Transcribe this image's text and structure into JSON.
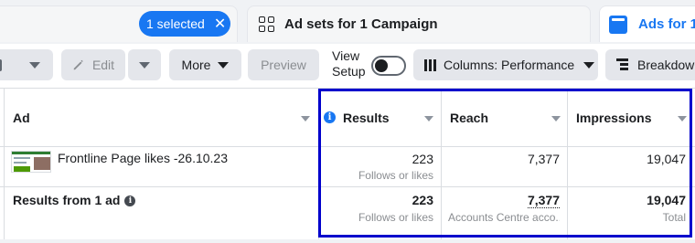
{
  "tabs": {
    "campaigns_selected_label": "1 selected",
    "adsets_label": "Ad sets for 1 Campaign",
    "ads_label": "Ads for 1"
  },
  "toolbar": {
    "edit_label": "Edit",
    "more_label": "More",
    "preview_label": "Preview",
    "view_setup_line1": "View",
    "view_setup_line2": "Setup",
    "columns_label": "Columns: Performance",
    "breakdown_label": "Breakdown"
  },
  "table": {
    "headers": {
      "ad": "Ad",
      "results": "Results",
      "reach": "Reach",
      "impressions": "Impressions"
    },
    "row": {
      "name": "Frontline Page likes -26.10.23",
      "results": "223",
      "results_sub": "Follows or likes",
      "reach": "7,377",
      "impressions": "19,047"
    },
    "summary": {
      "label": "Results from 1 ad",
      "results": "223",
      "results_sub": "Follows or likes",
      "reach": "7,377",
      "reach_sub": "Accounts Centre acco...",
      "impressions": "19,047",
      "impressions_sub": "Total"
    }
  },
  "colors": {
    "accent": "#1877f2",
    "highlight_box": "#0000cc"
  }
}
